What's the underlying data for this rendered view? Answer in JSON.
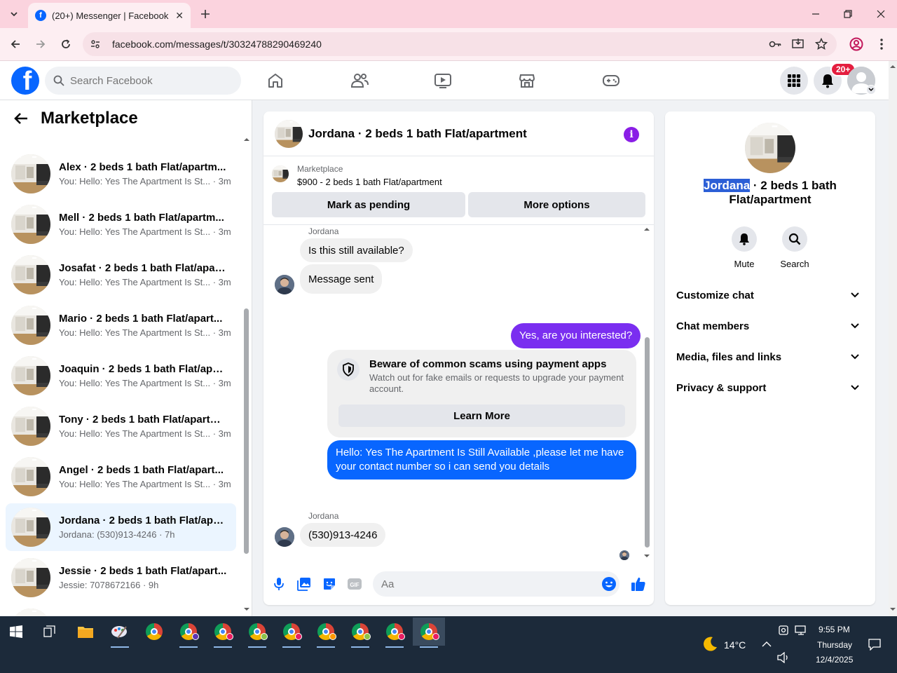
{
  "browser": {
    "tab_title": "(20+) Messenger | Facebook",
    "url": "facebook.com/messages/t/30324788290469240"
  },
  "fb": {
    "search_placeholder": "Search Facebook",
    "notification_badge": "20+"
  },
  "left_panel": {
    "title": "Marketplace",
    "chats": [
      {
        "name": "Alex · 2 beds 1 bath Flat/apartm...",
        "preview": "You: Hello: Yes The Apartment Is St... · 3m",
        "active": false
      },
      {
        "name": "Mell · 2 beds 1 bath Flat/apartm...",
        "preview": "You: Hello: Yes The Apartment Is St... · 3m",
        "active": false
      },
      {
        "name": "Josafat · 2 beds 1 bath Flat/apart...",
        "preview": "You: Hello: Yes The Apartment Is St... · 3m",
        "active": false
      },
      {
        "name": "Mario · 2 beds 1 bath Flat/apart...",
        "preview": "You: Hello: Yes The Apartment Is St... · 3m",
        "active": false
      },
      {
        "name": "Joaquin · 2 beds 1 bath Flat/apar...",
        "preview": "You: Hello: Yes The Apartment Is St... · 3m",
        "active": false
      },
      {
        "name": "Tony · 2 beds 1 bath Flat/apartm...",
        "preview": "You: Hello: Yes The Apartment Is St... · 3m",
        "active": false
      },
      {
        "name": "Angel · 2 beds 1 bath Flat/apart...",
        "preview": "You: Hello: Yes The Apartment Is St... · 3m",
        "active": false
      },
      {
        "name": "Jordana · 2 beds 1 bath Flat/apa...",
        "preview": "Jordana: (530)913-4246 · 7h",
        "active": true
      },
      {
        "name": "Jessie · 2 beds 1 bath Flat/apart...",
        "preview": "Jessie: 7078672166 · 9h",
        "active": false
      }
    ]
  },
  "conversation": {
    "title": "Jordana · 2 beds 1 bath Flat/apartment",
    "marketplace_label": "Marketplace",
    "listing": "$900 - 2 beds 1 bath Flat/apartment",
    "mark_pending": "Mark as pending",
    "more_options": "More options",
    "sender_name": "Jordana",
    "msg_1": "Is this still available?",
    "msg_2": "Message sent",
    "msg_3": "Yes, are you interested?",
    "scam_title": "Beware of common scams using payment apps",
    "scam_body": "Watch out for fake emails or requests to upgrade your payment account.",
    "learn_more": "Learn More",
    "msg_4": "Hello: Yes The Apartment Is Still Available ,please let me have your contact number so i can send you details",
    "sender_name_2": "Jordana",
    "msg_5": "(530)913-4246",
    "composer_placeholder": "Aa"
  },
  "details": {
    "name_highlight": "Jordana",
    "name_rest": " · 2 beds 1 bath Flat/apartment",
    "mute": "Mute",
    "search": "Search",
    "rows": [
      "Customize chat",
      "Chat members",
      "Media, files and links",
      "Privacy & support"
    ]
  },
  "taskbar": {
    "weather": "14°C",
    "time": "9:55 PM",
    "day": "Thursday",
    "date": "12/4/2025"
  }
}
